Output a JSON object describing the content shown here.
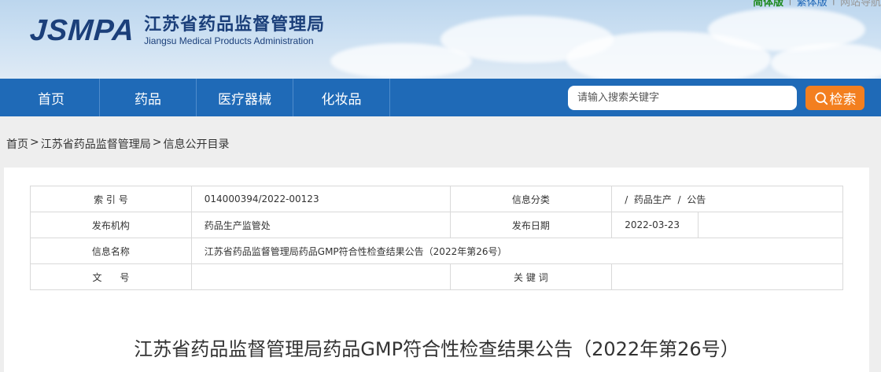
{
  "header": {
    "logo_mark": "JSMPA",
    "logo_cn": "江苏省药品监督管理局",
    "logo_en": "Jiangsu Medical Products Administration",
    "toplinks": {
      "simplified": "简体版",
      "sep1": "|",
      "traditional": "繁体版",
      "sep2": "|",
      "site_nav": "网站导航"
    }
  },
  "nav": {
    "items": [
      {
        "label": "首页"
      },
      {
        "label": "药品"
      },
      {
        "label": "医疗器械"
      },
      {
        "label": "化妆品"
      }
    ],
    "search_placeholder": "请输入搜索关键字",
    "search_button": "检索"
  },
  "breadcrumb": {
    "home": "首页",
    "sep1": ">",
    "agency": "江苏省药品监督管理局",
    "sep2": ">",
    "current": "信息公开目录"
  },
  "meta": {
    "index_label": "索 引 号",
    "index_value": "014000394/2022-00123",
    "category_label": "信息分类",
    "category_value": "/  药品生产  /  公告",
    "publisher_label": "发布机构",
    "publisher_value": "药品生产监管处",
    "date_label": "发布日期",
    "date_value": "2022-03-23",
    "name_label": "信息名称",
    "name_value": "江苏省药品监督管理局药品GMP符合性检查结果公告（2022年第26号）",
    "docno_label": "文      号",
    "docno_value": "",
    "keywords_label": "关 键 词",
    "keywords_value": ""
  },
  "article": {
    "title": "江苏省药品监督管理局药品GMP符合性检查结果公告（2022年第26号）"
  },
  "colors": {
    "nav_bg": "#1f6ab7",
    "search_button": "#f37f1f",
    "logo": "#1b3f7a"
  }
}
